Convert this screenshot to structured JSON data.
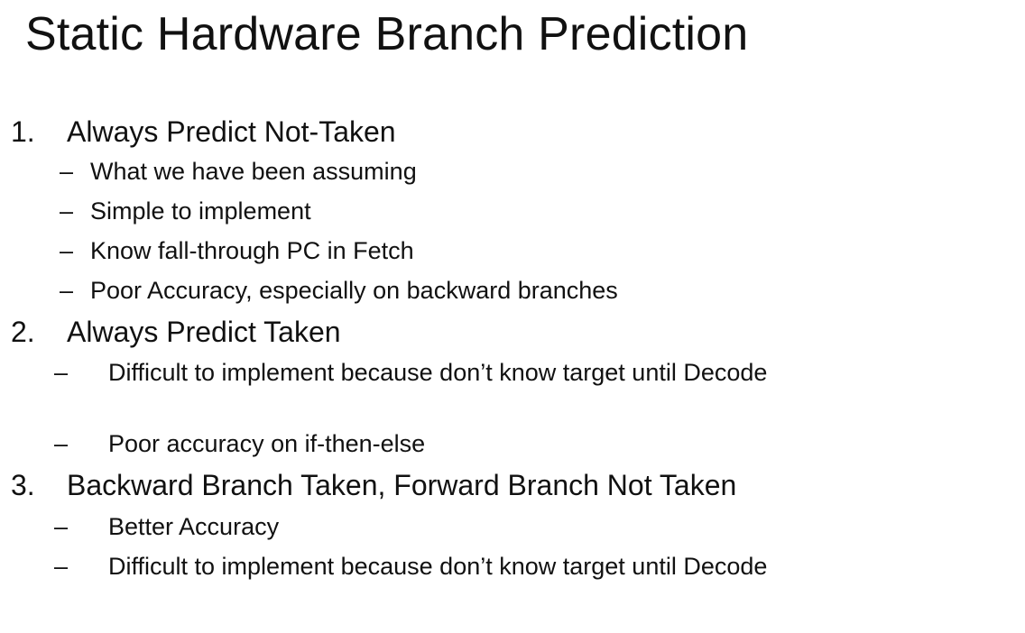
{
  "title": "Static Hardware Branch Prediction",
  "items": [
    {
      "number": "1.",
      "text": "Always Predict Not-Taken",
      "subitems": [
        {
          "dash": "–",
          "text": "What we have been assuming"
        },
        {
          "dash": "–",
          "text": "Simple to implement"
        },
        {
          "dash": "–",
          "text": "Know fall-through PC in Fetch"
        },
        {
          "dash": "–",
          "text": "Poor Accuracy, especially on backward branches"
        }
      ]
    },
    {
      "number": "2.",
      "text": "Always Predict Taken",
      "subitems": [
        {
          "dash": "–",
          "text": "Difficult to implement because don’t know target until Decode"
        },
        {
          "dash": "–",
          "text": "Poor accuracy on if-then-else"
        }
      ]
    },
    {
      "number": "3.",
      "text": "Backward Branch Taken, Forward Branch Not Taken",
      "subitems": [
        {
          "dash": "–",
          "text": "Better Accuracy"
        },
        {
          "dash": "–",
          "text": "Difficult to implement because don’t know target until Decode"
        }
      ]
    }
  ]
}
